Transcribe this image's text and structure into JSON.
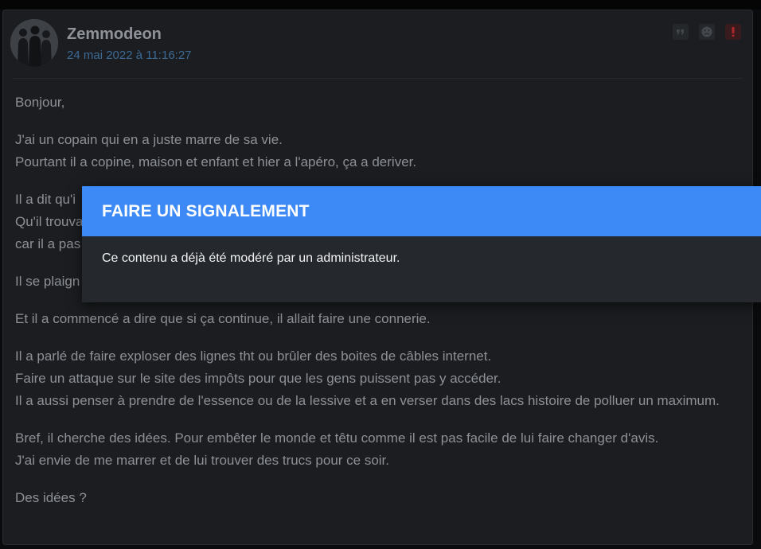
{
  "post": {
    "author": "Zemmodeon",
    "date": "24 mai 2022 à 11:16:27",
    "actions": [
      {
        "icon": "quote-icon",
        "color": "#44484d"
      },
      {
        "icon": "frown-icon",
        "color": "#44484d"
      },
      {
        "icon": "report-icon",
        "color": "#b3262d"
      }
    ],
    "paragraphs": [
      "Bonjour,",
      "J'ai un copain qui en a juste marre de sa vie.\nPourtant il a copine, maison et enfant et hier a l'apéro, ça a deriver.",
      "Il a dit qu'i\nQu'il trouva\ncar il a pas",
      "Il se plaign",
      "Et il a commencé a dire que si ça continue, il allait faire une connerie.",
      "Il a parlé de faire exploser des lignes tht ou brûler des boites de câbles internet.\nFaire un attaque sur le site des impôts pour que les gens puissent pas y accéder.\nIl a aussi penser à prendre de l'essence ou de la lessive et a en verser dans des lacs histoire de polluer un maximum.",
      "Bref, il cherche des idées. Pour embêter le monde et têtu comme il est pas facile de lui faire changer d'avis.\nJ'ai envie de me marrer et de lui trouver des trucs pour ce soir.",
      "Des idées ?"
    ]
  },
  "modal": {
    "title": "FAIRE UN SIGNALEMENT",
    "message": "Ce contenu a déjà été modéré par un administrateur."
  },
  "colors": {
    "accent": "#3d8af7",
    "background": "#1b1d20",
    "date_link": "#3c6a94"
  }
}
